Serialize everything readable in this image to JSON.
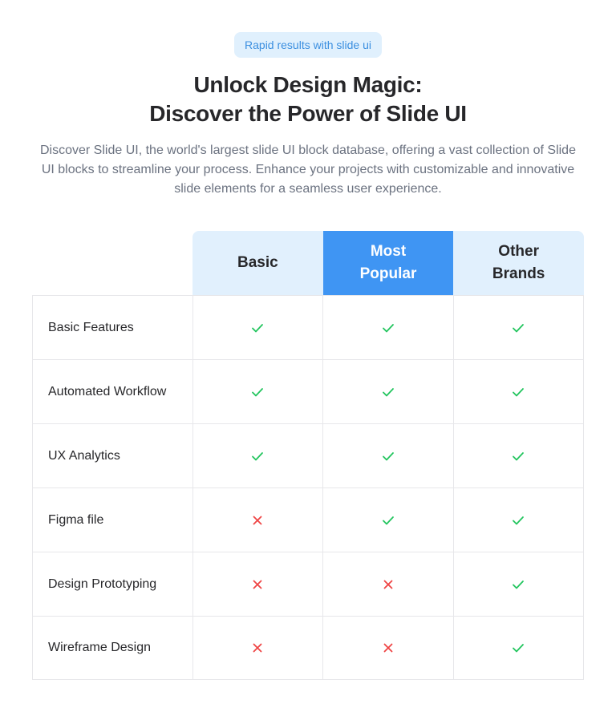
{
  "badge": "Rapid results with slide ui",
  "title": {
    "line1": "Unlock Design Magic:",
    "line2": "Discover the Power of Slide UI"
  },
  "description": "Discover Slide UI, the world's largest slide UI block database, offering a vast collection of Slide UI blocks to streamline your process. Enhance your projects with customizable and innovative slide elements for a seamless user experience.",
  "colors": {
    "check": "#22c55e",
    "cross": "#ef4444",
    "popular": "#3f95f3",
    "header": "#e1f0fd"
  },
  "columns": [
    {
      "key": "basic",
      "label": "Basic"
    },
    {
      "key": "popular",
      "label": "Most Popular"
    },
    {
      "key": "other",
      "label": "Other Brands"
    }
  ],
  "rows": [
    {
      "feature": "Basic Features",
      "values": [
        "check-icon",
        "check-icon",
        "check-icon"
      ]
    },
    {
      "feature": "Automated Workflow",
      "values": [
        "check-icon",
        "check-icon",
        "check-icon"
      ]
    },
    {
      "feature": "UX Analytics",
      "values": [
        "check-icon",
        "check-icon",
        "check-icon"
      ]
    },
    {
      "feature": "Figma file",
      "values": [
        "cross-icon",
        "check-icon",
        "check-icon"
      ]
    },
    {
      "feature": "Design Prototyping",
      "values": [
        "cross-icon",
        "cross-icon",
        "check-icon"
      ]
    },
    {
      "feature": "Wireframe Design",
      "values": [
        "cross-icon",
        "cross-icon",
        "check-icon"
      ]
    }
  ]
}
